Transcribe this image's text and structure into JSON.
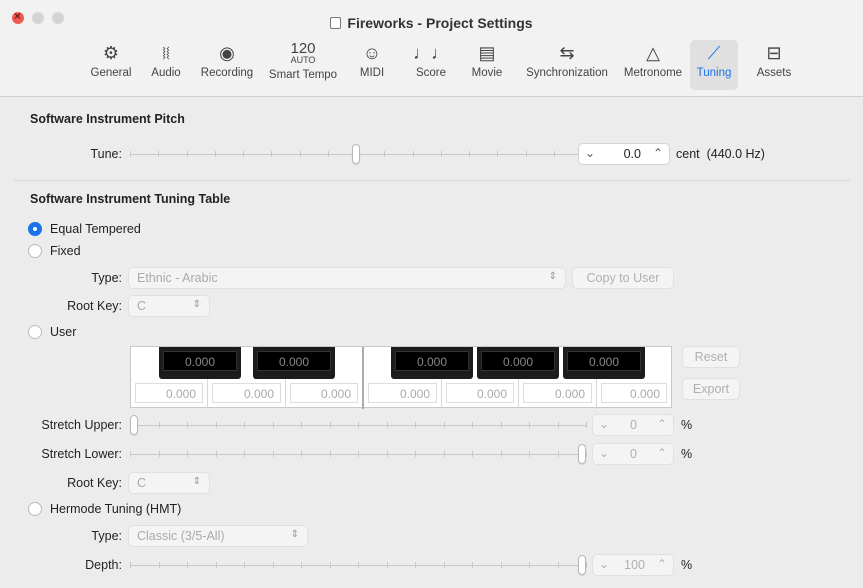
{
  "window": {
    "title": "Fireworks - Project Settings"
  },
  "toolbar": {
    "items": [
      {
        "label": "General",
        "icon": "gear-icon",
        "glyph": "⚙"
      },
      {
        "label": "Audio",
        "icon": "waveform-icon",
        "glyph": "〰"
      },
      {
        "label": "Recording",
        "icon": "record-icon",
        "glyph": "◉"
      },
      {
        "label": "Smart Tempo",
        "icon": "tempo-icon",
        "tempo_num": "120",
        "tempo_sub": "AUTO"
      },
      {
        "label": "MIDI",
        "icon": "midi-icon",
        "glyph": "☺"
      },
      {
        "label": "Score",
        "icon": "score-icon",
        "glyph": "♩♩"
      },
      {
        "label": "Movie",
        "icon": "movie-icon",
        "glyph": "▦"
      },
      {
        "label": "Synchronization",
        "icon": "sync-icon",
        "glyph": "⇆"
      },
      {
        "label": "Metronome",
        "icon": "metronome-icon",
        "glyph": "⚠"
      },
      {
        "label": "Tuning",
        "icon": "tuning-fork-icon",
        "glyph": "⸝",
        "active": true
      },
      {
        "label": "Assets",
        "icon": "briefcase-icon",
        "glyph": "⊟"
      }
    ]
  },
  "pitch": {
    "section_title": "Software Instrument Pitch",
    "tune_label": "Tune:",
    "tune_value": "0.0",
    "unit": "cent",
    "hz": "(440.0 Hz)",
    "tune_level": 0.5
  },
  "tuning_table": {
    "section_title": "Software Instrument Tuning Table",
    "equal_tempered": "Equal Tempered",
    "fixed": "Fixed",
    "type_label": "Type:",
    "type_value": "Ethnic - Arabic",
    "copy_button": "Copy to User",
    "root_key_label": "Root Key:",
    "root_key_value": "C",
    "user": "User",
    "black_keys": [
      "0.000",
      "0.000",
      "0.000",
      "0.000",
      "0.000"
    ],
    "white_keys": [
      "0.000",
      "0.000",
      "0.000",
      "0.000",
      "0.000",
      "0.000",
      "0.000"
    ],
    "reset_button": "Reset",
    "export_button": "Export",
    "stretch_upper_label": "Stretch Upper:",
    "stretch_upper_value": "0",
    "stretch_lower_label": "Stretch Lower:",
    "stretch_lower_value": "0",
    "percent": "%",
    "root_key2_label": "Root Key:",
    "root_key2_value": "C",
    "hermode": "Hermode Tuning (HMT)",
    "hmt_type_label": "Type:",
    "hmt_type_value": "Classic (3/5-All)",
    "depth_label": "Depth:",
    "depth_value": "100"
  }
}
